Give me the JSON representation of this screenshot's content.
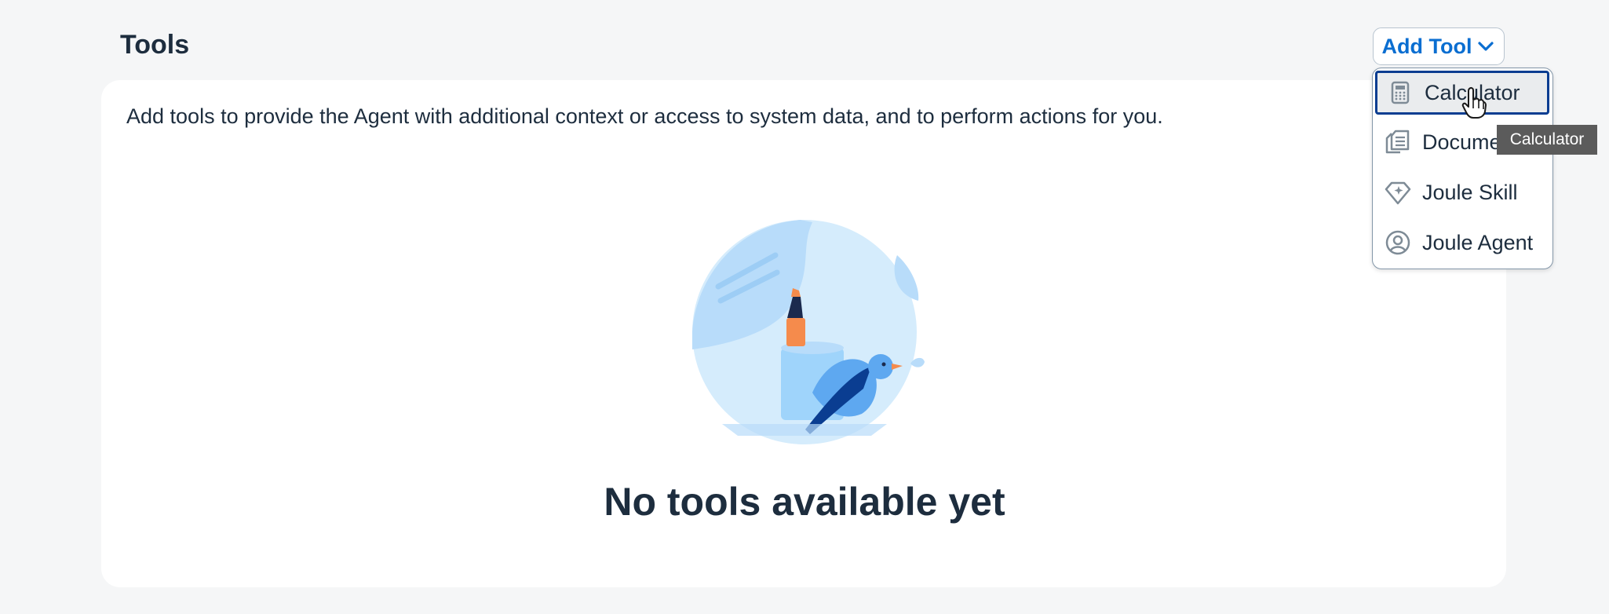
{
  "header": {
    "title": "Tools",
    "add_tool_label": "Add Tool"
  },
  "card": {
    "description": "Add tools to provide the Agent with additional context or access to system data, and to perform actions for you.",
    "empty_title": "No tools available yet"
  },
  "menu": {
    "items": [
      {
        "label": "Calculator",
        "icon": "calculator-icon",
        "selected": true
      },
      {
        "label": "Document",
        "icon": "document-icon",
        "selected": false
      },
      {
        "label": "Joule Skill",
        "icon": "diamond-icon",
        "selected": false
      },
      {
        "label": "Joule Agent",
        "icon": "user-circle-icon",
        "selected": false
      }
    ]
  },
  "tooltip": {
    "text": "Calculator"
  },
  "colors": {
    "accent": "#0a6ed1",
    "selection_border": "#0a3d91",
    "text": "#1d2d3e",
    "background": "#f5f6f7"
  }
}
